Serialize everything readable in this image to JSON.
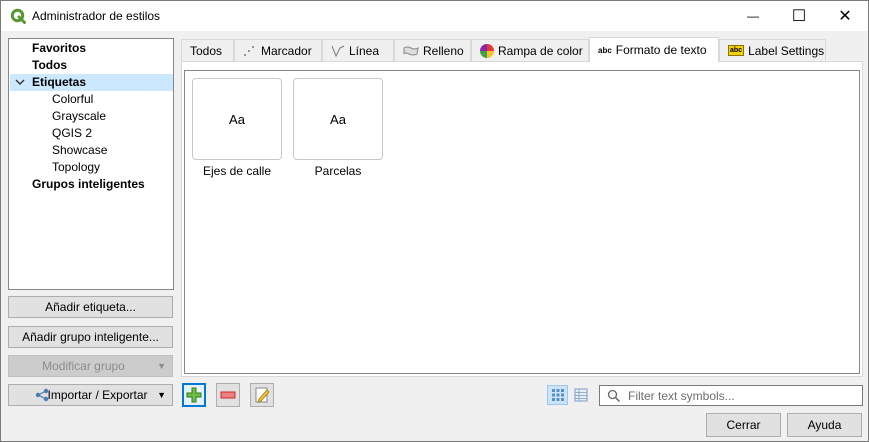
{
  "window": {
    "title": "Administrador de estilos",
    "min_glyph": "—",
    "max_glyph": "☐",
    "close_glyph": "✕"
  },
  "tree": {
    "items": [
      {
        "label": "Favoritos",
        "bold": true
      },
      {
        "label": "Todos",
        "bold": true
      },
      {
        "label": "Etiquetas",
        "bold": true,
        "expanded": true,
        "selected": true
      },
      {
        "label": "Colorful",
        "bold": false
      },
      {
        "label": "Grayscale",
        "bold": false
      },
      {
        "label": "QGIS 2",
        "bold": false
      },
      {
        "label": "Showcase",
        "bold": false
      },
      {
        "label": "Topology",
        "bold": false
      },
      {
        "label": "Grupos inteligentes",
        "bold": true
      }
    ]
  },
  "left_buttons": {
    "add_tag": "Añadir etiqueta...",
    "add_smart_group": "Añadir grupo inteligente...",
    "modify_group": "Modificar grupo",
    "import_export": "Importar / Exportar"
  },
  "tabs": [
    {
      "label": "Todos",
      "icon": "none"
    },
    {
      "label": "Marcador",
      "icon": "marker-icon"
    },
    {
      "label": "Línea",
      "icon": "line-icon"
    },
    {
      "label": "Relleno",
      "icon": "fill-icon"
    },
    {
      "label": "Rampa de color",
      "icon": "color-ramp-icon"
    },
    {
      "label": "Formato de texto",
      "icon": "text-format-icon",
      "icon_text": "abc",
      "active": true
    },
    {
      "label": "Label Settings",
      "icon": "label-settings-icon",
      "icon_text": "abc"
    }
  ],
  "symbols": [
    {
      "preview": "Aa",
      "label": "Ejes de calle"
    },
    {
      "preview": "Aa",
      "label": "Parcelas"
    }
  ],
  "toolbar": {
    "add_icon": "add-symbol-icon",
    "remove_icon": "remove-symbol-icon",
    "edit_icon": "edit-symbol-icon",
    "icon_view": "icon-view-icon",
    "list_view": "list-view-icon"
  },
  "search": {
    "placeholder": "Filter text symbols...",
    "value": ""
  },
  "footer": {
    "close": "Cerrar",
    "help": "Ayuda"
  },
  "colors": {
    "selection": "#cce8ff",
    "accent": "#0078d7",
    "qgis_green": "#589632"
  }
}
